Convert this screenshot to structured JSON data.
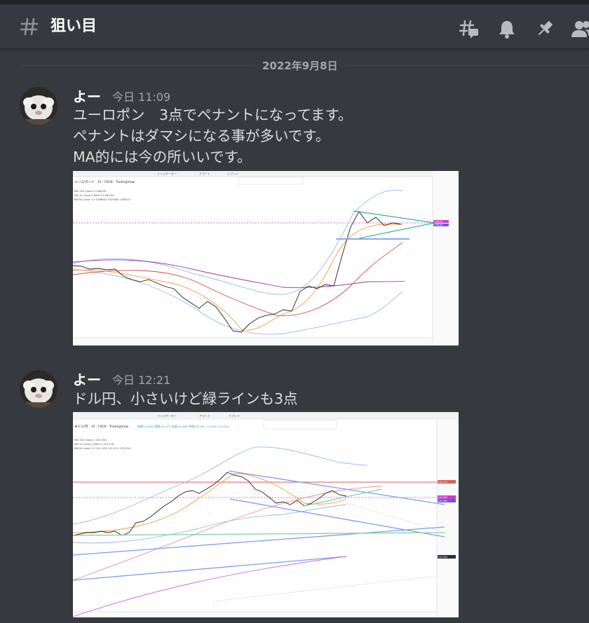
{
  "channel": {
    "name": "狙い目",
    "icons": [
      "threads-icon",
      "bell-icon",
      "pin-icon",
      "members-icon"
    ]
  },
  "date_divider": "2022年9月8日",
  "messages": [
    {
      "author": "よー",
      "timestamp": "今日 11:09",
      "lines": [
        "ユーロポン　3点でペナントになってます。",
        "ペナントはダマシになる事が多いです。",
        "MA的には今の所いいです。"
      ],
      "chart": {
        "symbol": "ユーロ/ポンド · 15 · FXCN · TradingView",
        "menu": [
          "インジケーター",
          "アラート",
          "リプレイ"
        ],
        "legend": [
          "MA 320 close 0  0.86290",
          "MA 20 close 0 SMA 9  0.86700",
          "BB 80 close 2.0  0.86605  0.87060  0.86015"
        ],
        "price_tags": [
          "0.86790",
          "0.86780"
        ],
        "colors": {
          "bb": "#9cb8f0",
          "ma_short": "#f59a3b",
          "ma_long": "#d94a45",
          "ma_purple": "#9c3aa0",
          "pennant": "#1ea38a",
          "support": "#8fa6ee",
          "dotted": "#c83ec8"
        }
      }
    },
    {
      "author": "よー",
      "timestamp": "今日 12:21",
      "lines": [
        "ドル円、小さいけど緑ラインも3点"
      ],
      "chart": {
        "symbol": "米ドル/円 · 15 · FXCN · TradingView",
        "ohlc": "始値142.895 高値142.971 安値142.862 終値142.950 +0.055 (+0.04%)",
        "menu": [
          "インジケーター",
          "アラート",
          "リプレイ"
        ],
        "legend": [
          "MA 320 close 0  140.458",
          "MA 20 close 0 SMA 9  143.478",
          "BB 80 close 2.0  141.209  142.914  139.424"
        ],
        "price_tags": [
          "143.170",
          "142.895",
          "142.950",
          "141.950"
        ],
        "colors": {
          "bb": "#9cb8f0",
          "ma_short": "#f59a3b",
          "ma_long": "#f08f8f",
          "ma_purple": "#c86cd8",
          "green_line": "#7fd4a6",
          "blue_line": "#7d9cf0",
          "dotted": "#c83ec8",
          "red_line": "#e05a5a"
        }
      }
    }
  ]
}
